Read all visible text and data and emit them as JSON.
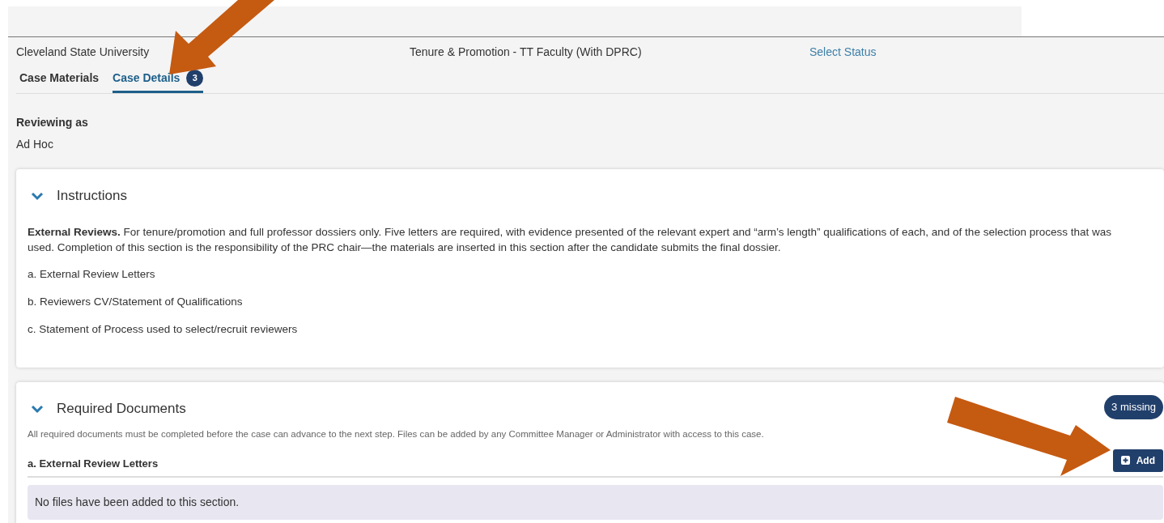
{
  "header": {
    "institution": "Cleveland State University",
    "case_type": "Tenure & Promotion - TT Faculty (With DPRC)",
    "status_link": "Select Status"
  },
  "tabs": [
    {
      "label": "Case Materials",
      "selected": false
    },
    {
      "label": "Case Details",
      "selected": true,
      "badge": "3"
    }
  ],
  "reviewing": {
    "label": "Reviewing as",
    "value": "Ad Hoc"
  },
  "instructions": {
    "title": "Instructions",
    "expanded": true,
    "paragraph": "**External Reviews.** For tenure/promotion and full professor dossiers only.  Five letters are required, with evidence presented of the relevant expert and “arm’s length” qualifications of each, and of the selection process that was used. Completion of this section is the responsibility of the PRC chair—the materials are inserted in this section after the candidate submits the final dossier.",
    "items": [
      "a. External Review Letters",
      "b. Reviewers CV/Statement of Qualifications",
      "c. Statement of Process used to select/recruit reviewers"
    ]
  },
  "required_documents": {
    "title": "Required Documents",
    "expanded": true,
    "missing_badge": "3 missing",
    "note": "All required documents must be completed before the case can advance to the next step. Files can be added by any Committee Manager or Administrator with access to this case.",
    "sections": [
      {
        "title": "a. External Review Letters",
        "add_button": "Add",
        "empty_message": "No files have been added to this section."
      }
    ]
  }
}
